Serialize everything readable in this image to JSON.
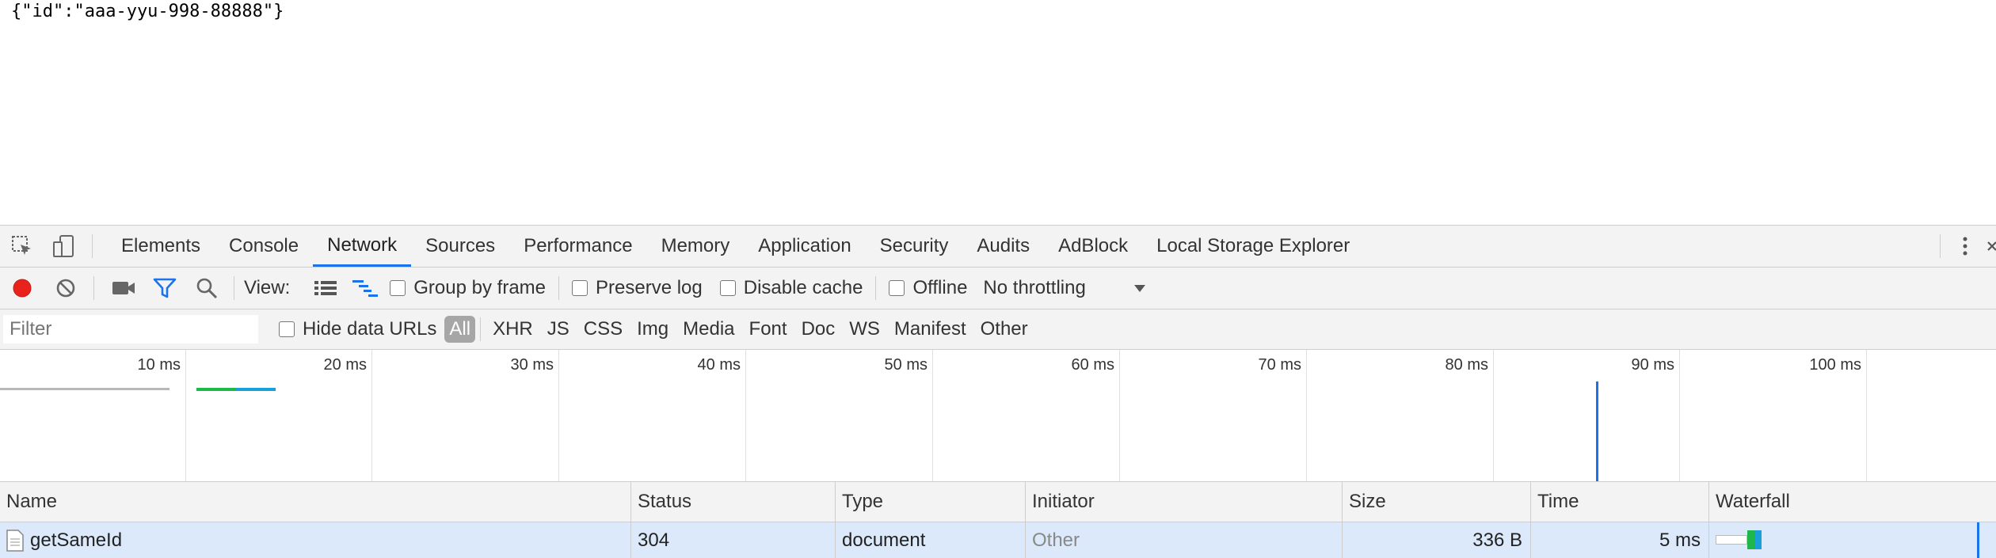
{
  "page": {
    "json_text": "{\"id\":\"aaa-yyu-998-88888\"}"
  },
  "devtools": {
    "tabs": [
      {
        "label": "Elements"
      },
      {
        "label": "Console"
      },
      {
        "label": "Network"
      },
      {
        "label": "Sources"
      },
      {
        "label": "Performance"
      },
      {
        "label": "Memory"
      },
      {
        "label": "Application"
      },
      {
        "label": "Security"
      },
      {
        "label": "Audits"
      },
      {
        "label": "AdBlock"
      },
      {
        "label": "Local Storage Explorer"
      }
    ],
    "active_tab": "Network",
    "toolbar": {
      "view_label": "View:",
      "group_by_frame": "Group by frame",
      "preserve_log": "Preserve log",
      "disable_cache": "Disable cache",
      "offline": "Offline",
      "throttling": "No throttling"
    },
    "filter": {
      "placeholder": "Filter",
      "hide_data_urls": "Hide data URLs",
      "types": [
        "All",
        "XHR",
        "JS",
        "CSS",
        "Img",
        "Media",
        "Font",
        "Doc",
        "WS",
        "Manifest",
        "Other"
      ]
    },
    "timeline_ticks": [
      "10 ms",
      "20 ms",
      "30 ms",
      "40 ms",
      "50 ms",
      "60 ms",
      "70 ms",
      "80 ms",
      "90 ms",
      "100 ms"
    ],
    "columns": [
      "Name",
      "Status",
      "Type",
      "Initiator",
      "Size",
      "Time",
      "Waterfall"
    ],
    "rows": [
      {
        "name": "getSameId",
        "status": "304",
        "type": "document",
        "initiator": "Other",
        "size": "336 B",
        "time": "5 ms"
      }
    ],
    "colors": {
      "accent": "#1a73e8",
      "record": "#e8231b",
      "row_selected": "#dce9fa"
    }
  }
}
